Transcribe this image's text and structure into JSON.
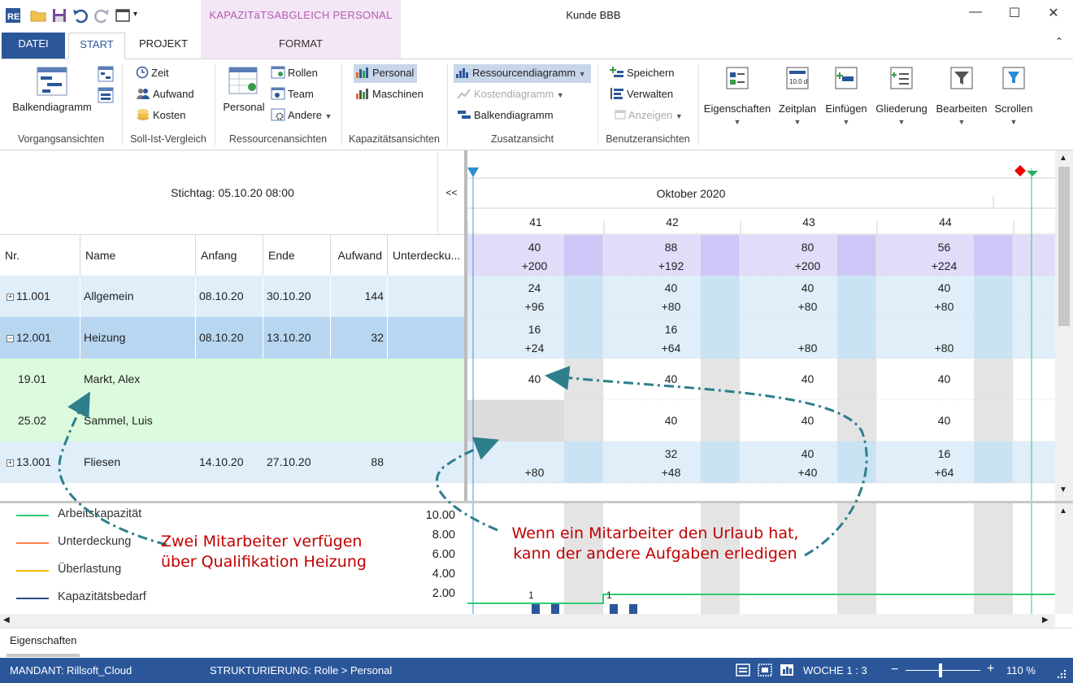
{
  "window": {
    "title": "Kunde BBB",
    "context_tab_group": "KAPAZITäTSABGLEICH PERSONAL"
  },
  "tabs": {
    "datei": "DATEI",
    "start": "START",
    "projekt": "PROJEKT",
    "format": "FORMAT"
  },
  "ribbon": {
    "vorgang": {
      "label": "Vorgangsansichten",
      "balken": "Balkendiagramm"
    },
    "sollist": {
      "label": "Soll-Ist-Vergleich",
      "zeit": "Zeit",
      "aufwand": "Aufwand",
      "kosten": "Kosten"
    },
    "ressource": {
      "label": "Ressourcenansichten",
      "personal": "Personal",
      "rollen": "Rollen",
      "team": "Team",
      "andere": "Andere"
    },
    "kapazitaet": {
      "label": "Kapazitätsansichten",
      "personal": "Personal",
      "maschinen": "Maschinen"
    },
    "zusatz": {
      "label": "Zusatzansicht",
      "ressourcendiagramm": "Ressourcendiagramm",
      "kostendiagramm": "Kostendiagramm",
      "balkendiagramm": "Balkendiagramm"
    },
    "benutzer": {
      "label": "Benutzeransichten",
      "speichern": "Speichern",
      "verwalten": "Verwalten",
      "anzeigen": "Anzeigen"
    },
    "tools": {
      "eigenschaften": "Eigenschaften",
      "zeitplan": "Zeitplan",
      "zeitplan_icon_text": "10.0 d",
      "einfuegen": "Einfügen",
      "gliederung": "Gliederung",
      "bearbeiten": "Bearbeiten",
      "scrollen": "Scrollen"
    }
  },
  "grid": {
    "stichtag": "Stichtag: 05.10.20 08:00",
    "collapse": "<<",
    "headers": {
      "nr": "Nr.",
      "name": "Name",
      "anfang": "Anfang",
      "ende": "Ende",
      "aufwand": "Aufwand",
      "unterdeckung": "Unterdecku..."
    },
    "rows": [
      {
        "nr": "11.001",
        "name": "Allgemein",
        "anfang": "08.10.20",
        "ende": "30.10.20",
        "aufwand": "144",
        "expander": "+"
      },
      {
        "nr": "12.001",
        "name": "Heizung",
        "anfang": "08.10.20",
        "ende": "13.10.20",
        "aufwand": "32",
        "expander": "−"
      },
      {
        "nr": "19.01",
        "name": "Markt, Alex",
        "anfang": "",
        "ende": "",
        "aufwand": ""
      },
      {
        "nr": "25.02",
        "name": "Sammel, Luis",
        "anfang": "",
        "ende": "",
        "aufwand": ""
      },
      {
        "nr": "13.001",
        "name": "Fliesen",
        "anfang": "14.10.20",
        "ende": "27.10.20",
        "aufwand": "88",
        "expander": "+"
      }
    ]
  },
  "timeline": {
    "month": "Oktober 2020",
    "weeks": [
      "41",
      "42",
      "43",
      "44"
    ],
    "summary": [
      {
        "a": "40",
        "b": "+200"
      },
      {
        "a": "88",
        "b": "+192"
      },
      {
        "a": "80",
        "b": "+200"
      },
      {
        "a": "56",
        "b": "+224"
      }
    ],
    "rows": [
      [
        {
          "a": "24",
          "b": "+96"
        },
        {
          "a": "40",
          "b": "+80"
        },
        {
          "a": "40",
          "b": "+80"
        },
        {
          "a": "40",
          "b": "+80"
        }
      ],
      [
        {
          "a": "16",
          "b": "+24"
        },
        {
          "a": "16",
          "b": "+64"
        },
        {
          "a": "",
          "b": "+80"
        },
        {
          "a": "",
          "b": "+80"
        }
      ],
      [
        {
          "a": "40",
          "b": ""
        },
        {
          "a": "40",
          "b": ""
        },
        {
          "a": "40",
          "b": ""
        },
        {
          "a": "40",
          "b": ""
        }
      ],
      [
        {
          "a": "",
          "b": ""
        },
        {
          "a": "40",
          "b": ""
        },
        {
          "a": "40",
          "b": ""
        },
        {
          "a": "40",
          "b": ""
        }
      ],
      [
        {
          "a": "",
          "b": "+80"
        },
        {
          "a": "32",
          "b": "+48"
        },
        {
          "a": "40",
          "b": "+40"
        },
        {
          "a": "16",
          "b": "+64"
        }
      ]
    ]
  },
  "chart": {
    "legend": [
      "Arbeitskapazität",
      "Unterdeckung",
      "Überlastung",
      "Kapazitätsbedarf"
    ],
    "colors": {
      "arbeitskapazitaet": "#2ecc71",
      "unterdeckung": "#ff7f50",
      "ueberlastung": "#f5b800",
      "bedarf": "#2b4a8a"
    },
    "yticks": [
      "10.00",
      "8.00",
      "6.00",
      "4.00",
      "2.00"
    ],
    "point_labels": [
      "1",
      "1"
    ]
  },
  "annotations": {
    "left": [
      "Zwei Mitarbeiter verfügen",
      "über Qualifikation Heizung"
    ],
    "right": [
      "Wenn ein Mitarbeiter den Urlaub hat,",
      "kann der andere Aufgaben erledigen"
    ]
  },
  "properties_panel": "Eigenschaften",
  "status": {
    "mandant": "MANDANT: Rillsoft_Cloud",
    "strukturierung": "STRUKTURIERUNG: Rolle > Personal",
    "woche": "WOCHE 1 : 3",
    "zoom": "110 %",
    "minus": "−",
    "plus": "+"
  },
  "accent": "#2b579a"
}
